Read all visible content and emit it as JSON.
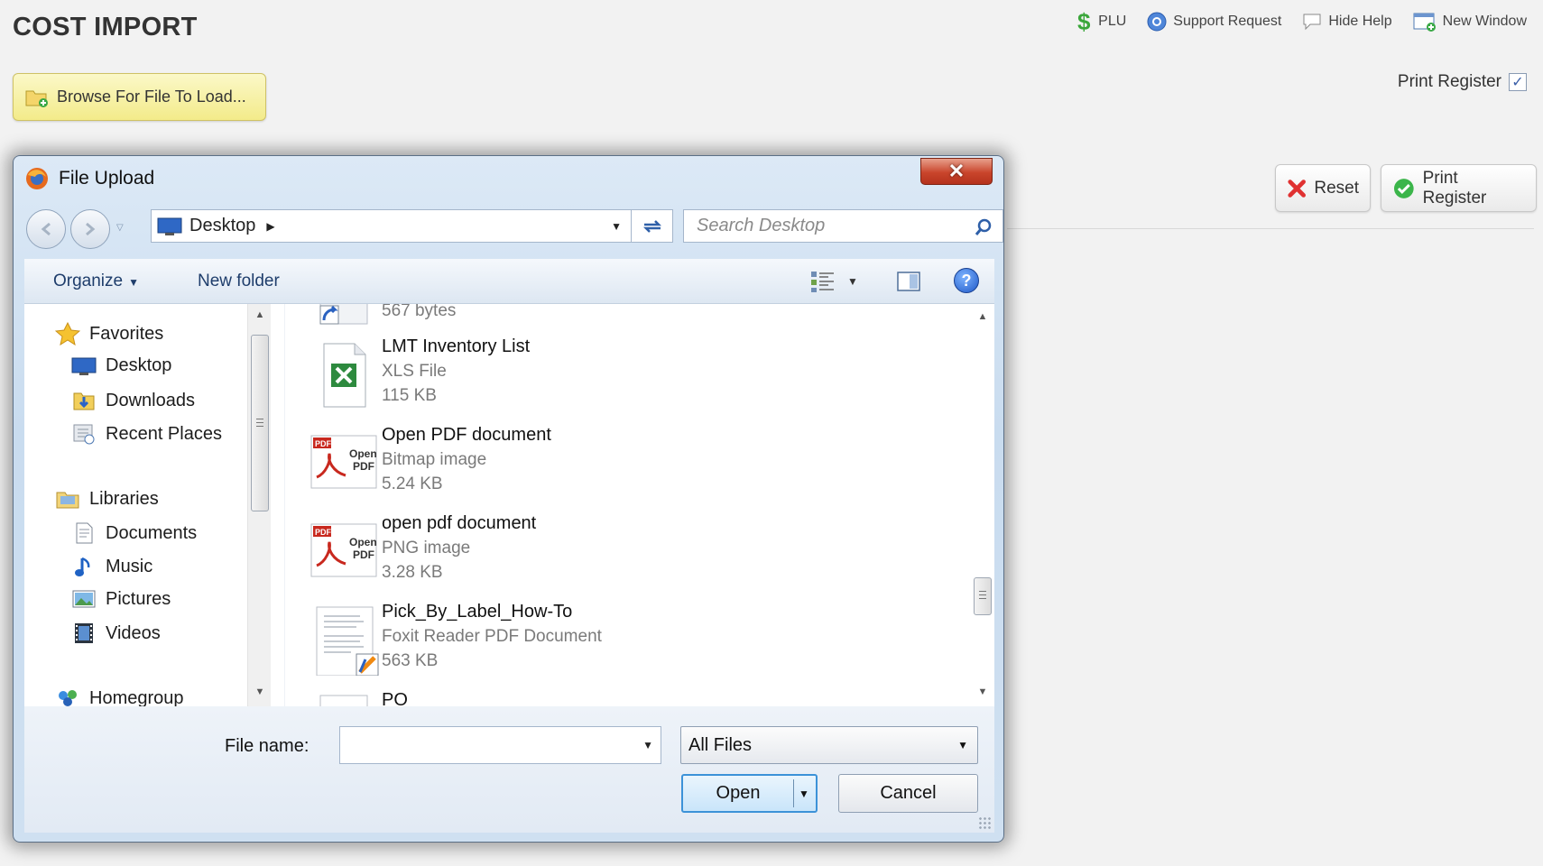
{
  "page": {
    "title": "COST IMPORT",
    "top_links": [
      {
        "label": "PLU",
        "icon": "dollar-icon"
      },
      {
        "label": "Support Request",
        "icon": "support-icon"
      },
      {
        "label": "Hide Help",
        "icon": "speech-bubble-icon"
      },
      {
        "label": "New Window",
        "icon": "new-window-icon"
      }
    ],
    "browse_button": "Browse For File To Load...",
    "print_register_label": "Print Register",
    "print_register_checked": true,
    "reset_button": "Reset",
    "print_register_button": "Print Register"
  },
  "dialog": {
    "title": "File Upload",
    "address": "Desktop",
    "search_placeholder": "Search Desktop",
    "toolbar": {
      "organize": "Organize",
      "new_folder": "New folder"
    },
    "nav": {
      "favorites": "Favorites",
      "favorites_items": [
        "Desktop",
        "Downloads",
        "Recent Places"
      ],
      "libraries": "Libraries",
      "libraries_items": [
        "Documents",
        "Music",
        "Pictures",
        "Videos"
      ],
      "homegroup": "Homegroup"
    },
    "files": [
      {
        "name": "",
        "type": "",
        "size": "567 bytes",
        "icon": "shortcut-icon"
      },
      {
        "name": "LMT Inventory List",
        "type": "XLS File",
        "size": "115 KB",
        "icon": "excel-icon"
      },
      {
        "name": "Open PDF document",
        "type": "Bitmap image",
        "size": "5.24 KB",
        "icon": "pdf-icon"
      },
      {
        "name": "open pdf document",
        "type": "PNG image",
        "size": "3.28 KB",
        "icon": "pdf-icon"
      },
      {
        "name": "Pick_By_Label_How-To",
        "type": "Foxit Reader PDF Document",
        "size": "563 KB",
        "icon": "foxit-document-icon"
      },
      {
        "name": "PO",
        "type": "",
        "size": "",
        "icon": "file-icon"
      }
    ],
    "file_name_label": "File name:",
    "file_name_value": "",
    "file_type": "All Files",
    "open_button": "Open",
    "cancel_button": "Cancel",
    "colors": {
      "accent": "#3c92d8",
      "close": "#c9452c",
      "browse": "#f3eb8a"
    }
  }
}
